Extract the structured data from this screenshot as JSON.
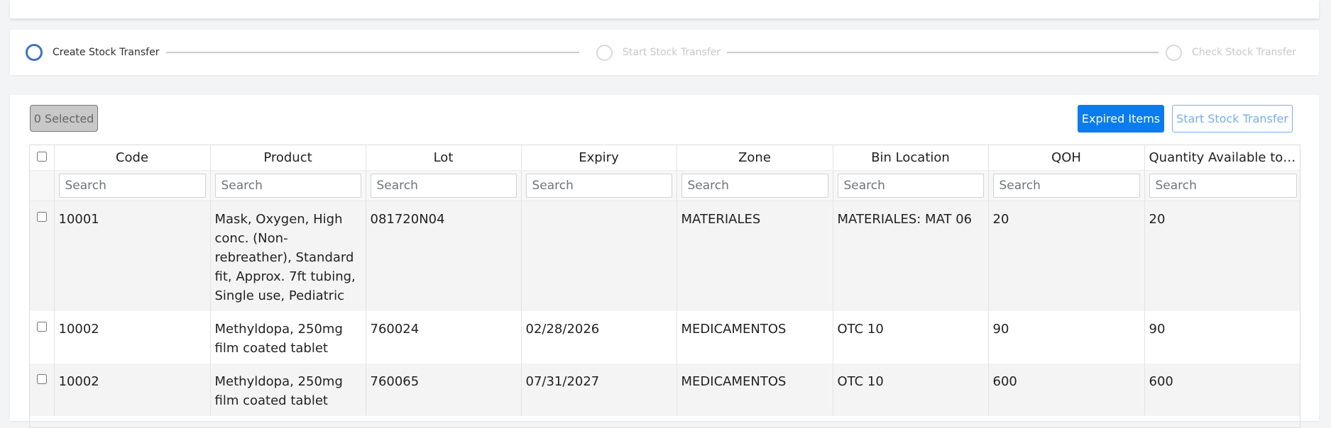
{
  "stepper": {
    "steps": [
      {
        "label": "Create Stock Transfer",
        "active": true
      },
      {
        "label": "Start Stock Transfer",
        "active": false
      },
      {
        "label": "Check Stock Transfer",
        "active": false
      }
    ]
  },
  "toolbar": {
    "selected_label": "0 Selected",
    "expired_label": "Expired Items",
    "start_label": "Start Stock Transfer"
  },
  "table": {
    "columns": [
      "Code",
      "Product",
      "Lot",
      "Expiry",
      "Zone",
      "Bin Location",
      "QOH",
      "Quantity Available to T..."
    ],
    "search_placeholder": "Search",
    "rows": [
      {
        "code": "10001",
        "product": "Mask, Oxygen, High conc. (Non-rebreather), Standard fit, Approx. 7ft tubing, Single use, Pediatric",
        "lot": "081720N04",
        "expiry": "",
        "zone": "MATERIALES",
        "bin": "MATERIALES: MAT 06",
        "qoh": "20",
        "qty": "20"
      },
      {
        "code": "10002",
        "product": "Methyldopa, 250mg film coated tablet",
        "lot": "760024",
        "expiry": "02/28/2026",
        "zone": "MEDICAMENTOS",
        "bin": "OTC 10",
        "qoh": "90",
        "qty": "90"
      },
      {
        "code": "10002",
        "product": "Methyldopa, 250mg film coated tablet",
        "lot": "760065",
        "expiry": "07/31/2027",
        "zone": "MEDICAMENTOS",
        "bin": "OTC 10",
        "qoh": "600",
        "qty": "600"
      }
    ]
  },
  "colors": {
    "accent": "#0a7cf0",
    "active_step": "#3f73c4"
  }
}
